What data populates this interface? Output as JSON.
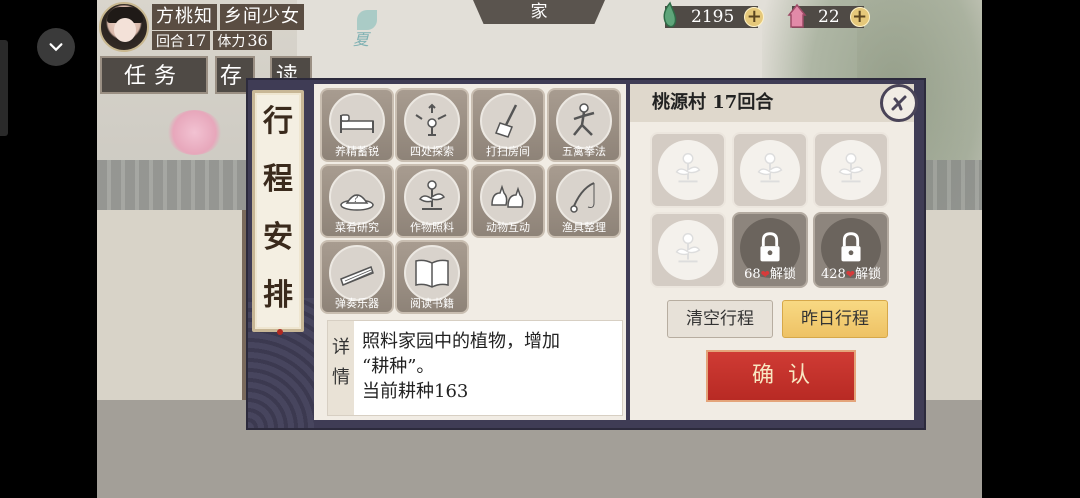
{
  "hud": {
    "name": "方桃知",
    "title": "乡间少女",
    "turn_label": "回合",
    "turn_value": "17",
    "stamina_label": "体力",
    "stamina_value": "36",
    "season": "夏",
    "home_tab": "家",
    "currency_a": "2195",
    "currency_b": "22",
    "plus": "+"
  },
  "main_buttons": {
    "task": "任务",
    "bag": "存",
    "read": "读"
  },
  "dialog": {
    "title_chars": [
      "行",
      "程",
      "安",
      "排"
    ],
    "actions": [
      {
        "label": "养精蓄锐",
        "icon": "bed-icon"
      },
      {
        "label": "四处探索",
        "icon": "explore-icon"
      },
      {
        "label": "打扫房间",
        "icon": "broom-icon"
      },
      {
        "label": "五禽拳法",
        "icon": "martial-arts-icon"
      },
      {
        "label": "菜肴研究",
        "icon": "dish-icon"
      },
      {
        "label": "作物照料",
        "icon": "sprout-icon"
      },
      {
        "label": "动物互动",
        "icon": "chicken-icon"
      },
      {
        "label": "渔具整理",
        "icon": "fishing-rod-icon"
      },
      {
        "label": "弹奏乐器",
        "icon": "zither-icon"
      },
      {
        "label": "阅读书籍",
        "icon": "book-icon"
      }
    ],
    "detail_label": "详情",
    "detail_line1": "照料家园中的植物，增加",
    "detail_line2": "“耕种”。",
    "detail_line3": "当前耕种163",
    "schedule_header": "桃源村 17回合",
    "locked_slots": [
      {
        "cost": "68",
        "action": "解锁"
      },
      {
        "cost": "428",
        "action": "解锁"
      }
    ],
    "clear_button": "清空行程",
    "yesterday_button": "昨日行程",
    "confirm_button": "确认"
  },
  "colors": {
    "panel_dark": "#3f3c55",
    "confirm_red": "#c0312a",
    "yesterday_gold": "#f2c96e"
  }
}
